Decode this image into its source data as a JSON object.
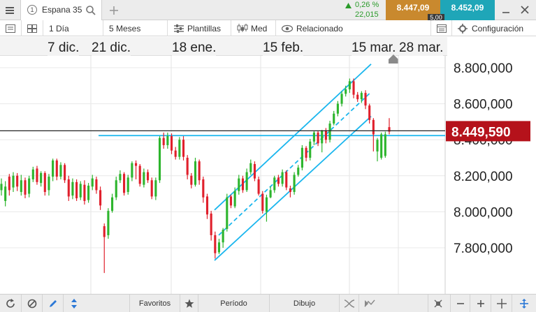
{
  "tabbar": {
    "menu_icon": "hamburger-icon",
    "symbol_number": "1",
    "symbol_name": "Espana 35",
    "search_icon": "search-icon",
    "add_icon": "plus-icon",
    "change_pct": "0,26 %",
    "change_abs": "22,015",
    "sell_price": "8.447,09",
    "buy_price": "8.452,09",
    "spread": "5,00",
    "sell_color": "#c9892e",
    "buy_color": "#1fa6b8"
  },
  "toolbar": {
    "interval": "1 Día",
    "range": "5 Meses",
    "templates": "Plantillas",
    "chart_type": "Med",
    "related": "Relacionado",
    "settings": "Configuración"
  },
  "bottombar": {
    "favorites": "Favoritos",
    "period": "Período",
    "drawing": "Dibujo"
  },
  "colors": {
    "up": "#2db52d",
    "down": "#e0202c",
    "channel": "#1ab6ee",
    "price_tag": "#b5121b"
  },
  "chart_data": {
    "type": "candlestick",
    "x_tick_labels": [
      "7 dic.",
      "21 dic.",
      "18 ene.",
      "15 feb.",
      "15 mar.",
      "28 mar."
    ],
    "y_tick_labels": [
      "8.800,000",
      "8.600,000",
      "8.400,000",
      "8.200,000",
      "8.000,000",
      "7.800,000"
    ],
    "ylim": [
      7610,
      8935
    ],
    "current_price": 8449.59,
    "current_price_label": "8.449,590",
    "horizontal_line": 8423,
    "candles": [
      [
        8120,
        8155,
        8090,
        8185
      ],
      [
        8060,
        8140,
        8030,
        8170
      ],
      [
        8195,
        8120,
        8090,
        8210
      ],
      [
        8135,
        8200,
        8110,
        8220
      ],
      [
        8200,
        8140,
        8115,
        8215
      ],
      [
        8110,
        8175,
        8090,
        8205
      ],
      [
        8175,
        8095,
        8075,
        8190
      ],
      [
        8100,
        8185,
        8080,
        8200
      ],
      [
        8180,
        8235,
        8165,
        8250
      ],
      [
        8240,
        8165,
        8150,
        8255
      ],
      [
        8160,
        8215,
        8140,
        8225
      ],
      [
        8215,
        8110,
        8090,
        8225
      ],
      [
        8120,
        8195,
        8090,
        8210
      ],
      [
        8195,
        8285,
        8170,
        8295
      ],
      [
        8285,
        8195,
        8175,
        8295
      ],
      [
        8195,
        8260,
        8180,
        8275
      ],
      [
        8260,
        8175,
        8160,
        8270
      ],
      [
        8180,
        8085,
        8060,
        8200
      ],
      [
        8090,
        8165,
        8070,
        8185
      ],
      [
        8165,
        8075,
        8060,
        8180
      ],
      [
        8080,
        8155,
        8065,
        8170
      ],
      [
        8150,
        8060,
        8040,
        8175
      ],
      [
        8065,
        8145,
        8050,
        8160
      ],
      [
        8140,
        8185,
        8120,
        8205
      ],
      [
        8180,
        8120,
        8100,
        8195
      ],
      [
        8120,
        8035,
        8010,
        8140
      ],
      [
        7920,
        7860,
        7660,
        7935
      ],
      [
        7870,
        8005,
        7850,
        8020
      ],
      [
        8005,
        8080,
        7995,
        8100
      ],
      [
        8080,
        8175,
        8065,
        8195
      ],
      [
        8175,
        8210,
        8160,
        8230
      ],
      [
        8210,
        8105,
        8090,
        8220
      ],
      [
        8110,
        8190,
        8095,
        8205
      ],
      [
        8190,
        8270,
        8170,
        8280
      ],
      [
        8270,
        8255,
        8180,
        8285
      ],
      [
        8255,
        8155,
        8140,
        8265
      ],
      [
        8150,
        8220,
        8135,
        8240
      ],
      [
        8220,
        8175,
        8160,
        8235
      ],
      [
        8175,
        8085,
        8070,
        8190
      ],
      [
        8085,
        8175,
        8065,
        8190
      ],
      [
        8175,
        8410,
        8160,
        8420
      ],
      [
        8410,
        8370,
        8350,
        8440
      ],
      [
        8370,
        8420,
        8350,
        8440
      ],
      [
        8420,
        8340,
        8320,
        8435
      ],
      [
        8340,
        8305,
        8290,
        8360
      ],
      [
        8305,
        8400,
        8290,
        8415
      ],
      [
        8400,
        8305,
        8285,
        8420
      ],
      [
        8300,
        8205,
        8180,
        8315
      ],
      [
        8200,
        8150,
        8130,
        8215
      ],
      [
        8150,
        8280,
        8140,
        8300
      ],
      [
        8280,
        8175,
        8150,
        8290
      ],
      [
        8180,
        8080,
        8050,
        8195
      ],
      [
        8085,
        7985,
        7960,
        8100
      ],
      [
        7990,
        7870,
        7840,
        8005
      ],
      [
        7870,
        7770,
        7740,
        7890
      ],
      [
        7775,
        7830,
        7765,
        7850
      ],
      [
        7830,
        7900,
        7800,
        7910
      ],
      [
        7905,
        8080,
        7890,
        8100
      ],
      [
        8085,
        8035,
        8020,
        8095
      ],
      [
        8030,
        8115,
        8020,
        8135
      ],
      [
        8115,
        8185,
        8095,
        8205
      ],
      [
        8185,
        8120,
        8105,
        8200
      ],
      [
        8120,
        8220,
        8110,
        8240
      ],
      [
        8220,
        8270,
        8205,
        8290
      ],
      [
        8265,
        8185,
        8170,
        8280
      ],
      [
        8180,
        8100,
        8090,
        8195
      ],
      [
        8100,
        8005,
        7990,
        8115
      ],
      [
        8000,
        8080,
        7945,
        8095
      ],
      [
        8080,
        8120,
        8075,
        8140
      ],
      [
        8120,
        8190,
        8105,
        8200
      ],
      [
        8190,
        8155,
        8140,
        8205
      ],
      [
        8155,
        8220,
        8140,
        8235
      ],
      [
        8220,
        8135,
        8120,
        8230
      ],
      [
        8130,
        8110,
        8080,
        8145
      ],
      [
        8110,
        8205,
        8095,
        8220
      ],
      [
        8205,
        8245,
        8195,
        8260
      ],
      [
        8245,
        8355,
        8230,
        8370
      ],
      [
        8355,
        8300,
        8280,
        8365
      ],
      [
        8300,
        8390,
        8285,
        8405
      ],
      [
        8390,
        8440,
        8370,
        8450
      ],
      [
        8440,
        8380,
        8365,
        8450
      ],
      [
        8380,
        8450,
        8330,
        8455
      ],
      [
        8450,
        8400,
        8380,
        8465
      ],
      [
        8400,
        8490,
        8385,
        8505
      ],
      [
        8490,
        8545,
        8480,
        8560
      ],
      [
        8545,
        8600,
        8530,
        8615
      ],
      [
        8600,
        8655,
        8585,
        8670
      ],
      [
        8655,
        8680,
        8640,
        8700
      ],
      [
        8680,
        8725,
        8660,
        8740
      ],
      [
        8725,
        8650,
        8630,
        8740
      ],
      [
        8650,
        8625,
        8610,
        8665
      ],
      [
        8625,
        8660,
        8605,
        8670
      ],
      [
        8660,
        8590,
        8570,
        8675
      ],
      [
        8590,
        8510,
        8490,
        8600
      ],
      [
        8510,
        8430,
        8335,
        8520
      ],
      [
        8335,
        8400,
        8280,
        8410
      ],
      [
        8300,
        8430,
        8290,
        8440
      ],
      [
        8310,
        8430,
        8300,
        8445
      ],
      [
        8470,
        8445,
        8430,
        8520
      ]
    ]
  }
}
